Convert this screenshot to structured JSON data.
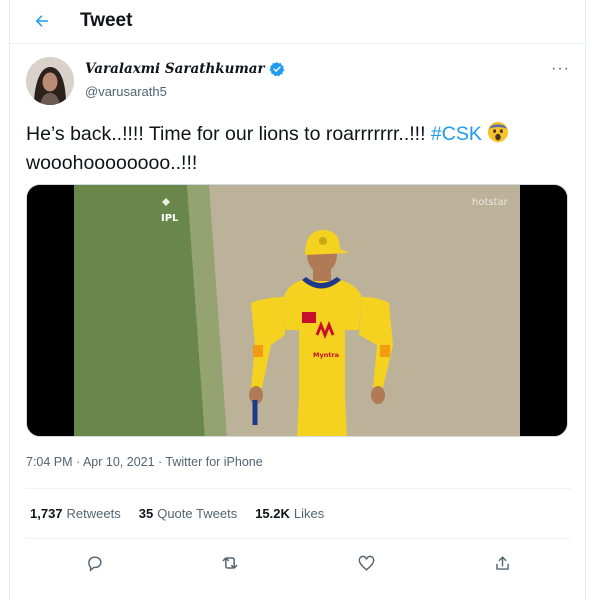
{
  "header": {
    "title": "Tweet",
    "back_icon": "arrow-left-icon"
  },
  "tweet": {
    "author": {
      "display_name": "Varalaxmi Sarathkumar",
      "handle": "@varusarath5",
      "verified_icon": "verified-badge-icon"
    },
    "text": {
      "part1": "He’s back..!!!! Time for our lions to roarrrrrrr..!!! ",
      "hashtag": "#CSK",
      "part2": "wooohoooooooo..!!!",
      "emoji_icon": "fearful-face-emoji-icon"
    },
    "media": {
      "broadcaster_watermark": "hotstar",
      "league_logo_text": "IPL",
      "jersey_sponsor": "Myntra"
    },
    "timestamp": "7:04 PM · Apr 10, 2021 · Twitter for iPhone",
    "stats": {
      "retweets_count": "1,737",
      "retweets_label": "Retweets",
      "quotes_count": "35",
      "quotes_label": "Quote Tweets",
      "likes_count": "15.2K",
      "likes_label": "Likes"
    }
  },
  "colors": {
    "accent": "#1d9bf0",
    "jersey_yellow": "#f4d21f",
    "pitch_green": "#6f8f4e"
  }
}
